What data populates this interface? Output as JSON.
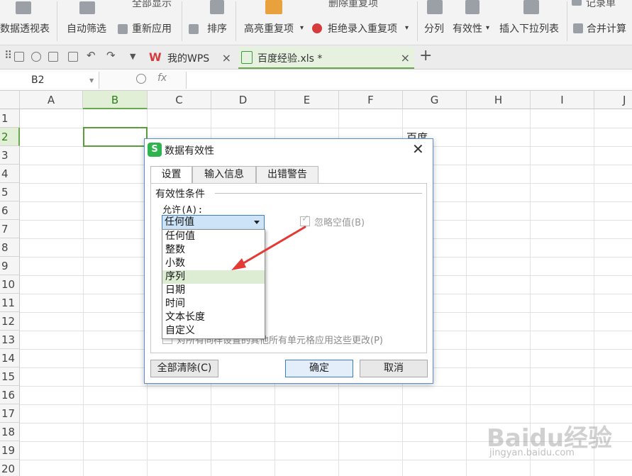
{
  "ribbon": {
    "items": [
      {
        "label": "数据透视表"
      },
      {
        "label": "自动筛选"
      },
      {
        "label": "全部显示"
      },
      {
        "label": "重新应用"
      },
      {
        "label": "排序"
      },
      {
        "label": "高亮重复项"
      },
      {
        "label": "删除重复项"
      },
      {
        "label": "拒绝录入重复项"
      },
      {
        "label": "分列"
      },
      {
        "label": "有效性"
      },
      {
        "label": "插入下拉列表"
      },
      {
        "label": "记录单"
      },
      {
        "label": "合并计算"
      }
    ]
  },
  "tabs": [
    {
      "label": "我的WPS",
      "icon": "wps-logo-icon"
    },
    {
      "label": "百度经验.xls *",
      "icon": "spreadsheet-file-icon"
    }
  ],
  "formula_bar": {
    "cell_ref": "B2",
    "fx": "fx"
  },
  "grid": {
    "columns": [
      "A",
      "B",
      "C",
      "D",
      "E",
      "F",
      "G",
      "H",
      "I",
      "J"
    ],
    "rows": [
      "1",
      "2",
      "3",
      "4",
      "5",
      "6",
      "7",
      "8",
      "9",
      "10",
      "11",
      "12",
      "13",
      "14",
      "15",
      "16",
      "17",
      "18",
      "19",
      "20"
    ],
    "selected_cell": "B2",
    "cells": {
      "G2": "百度"
    }
  },
  "dialog": {
    "title": "数据有效性",
    "tabs": [
      "设置",
      "输入信息",
      "出错警告"
    ],
    "active_tab": "设置",
    "section_title": "有效性条件",
    "allow_label": "允许(A):",
    "allow_value": "任何值",
    "ignore_blank": "忽略空值(B)",
    "apply_all": "对所有同样设置的其他所有单元格应用这些更改(P)",
    "dropdown_options": [
      "任何值",
      "整数",
      "小数",
      "序列",
      "日期",
      "时间",
      "文本长度",
      "自定义"
    ],
    "highlighted_option": "序列",
    "buttons": {
      "clear": "全部清除(C)",
      "ok": "确定",
      "cancel": "取消"
    }
  },
  "annotation_color": "#e53935",
  "watermark": {
    "text": "Baidu经验",
    "sub": "jingyan.baidu.com"
  }
}
